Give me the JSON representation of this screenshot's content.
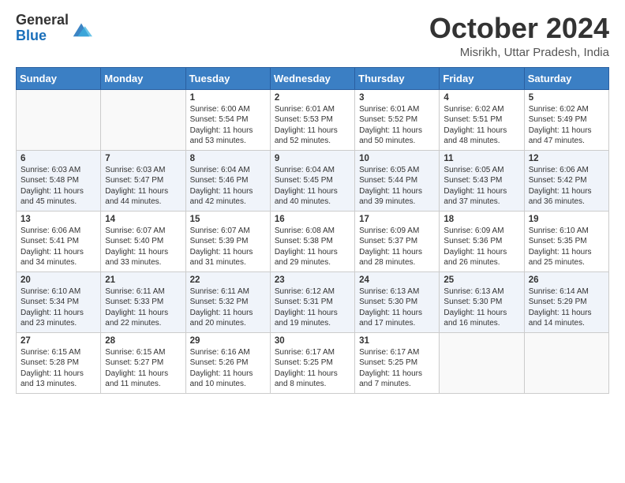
{
  "header": {
    "logo_general": "General",
    "logo_blue": "Blue",
    "month_title": "October 2024",
    "location": "Misrikh, Uttar Pradesh, India"
  },
  "days_of_week": [
    "Sunday",
    "Monday",
    "Tuesday",
    "Wednesday",
    "Thursday",
    "Friday",
    "Saturday"
  ],
  "weeks": [
    [
      {
        "day": "",
        "info": ""
      },
      {
        "day": "",
        "info": ""
      },
      {
        "day": "1",
        "info": "Sunrise: 6:00 AM\nSunset: 5:54 PM\nDaylight: 11 hours and 53 minutes."
      },
      {
        "day": "2",
        "info": "Sunrise: 6:01 AM\nSunset: 5:53 PM\nDaylight: 11 hours and 52 minutes."
      },
      {
        "day": "3",
        "info": "Sunrise: 6:01 AM\nSunset: 5:52 PM\nDaylight: 11 hours and 50 minutes."
      },
      {
        "day": "4",
        "info": "Sunrise: 6:02 AM\nSunset: 5:51 PM\nDaylight: 11 hours and 48 minutes."
      },
      {
        "day": "5",
        "info": "Sunrise: 6:02 AM\nSunset: 5:49 PM\nDaylight: 11 hours and 47 minutes."
      }
    ],
    [
      {
        "day": "6",
        "info": "Sunrise: 6:03 AM\nSunset: 5:48 PM\nDaylight: 11 hours and 45 minutes."
      },
      {
        "day": "7",
        "info": "Sunrise: 6:03 AM\nSunset: 5:47 PM\nDaylight: 11 hours and 44 minutes."
      },
      {
        "day": "8",
        "info": "Sunrise: 6:04 AM\nSunset: 5:46 PM\nDaylight: 11 hours and 42 minutes."
      },
      {
        "day": "9",
        "info": "Sunrise: 6:04 AM\nSunset: 5:45 PM\nDaylight: 11 hours and 40 minutes."
      },
      {
        "day": "10",
        "info": "Sunrise: 6:05 AM\nSunset: 5:44 PM\nDaylight: 11 hours and 39 minutes."
      },
      {
        "day": "11",
        "info": "Sunrise: 6:05 AM\nSunset: 5:43 PM\nDaylight: 11 hours and 37 minutes."
      },
      {
        "day": "12",
        "info": "Sunrise: 6:06 AM\nSunset: 5:42 PM\nDaylight: 11 hours and 36 minutes."
      }
    ],
    [
      {
        "day": "13",
        "info": "Sunrise: 6:06 AM\nSunset: 5:41 PM\nDaylight: 11 hours and 34 minutes."
      },
      {
        "day": "14",
        "info": "Sunrise: 6:07 AM\nSunset: 5:40 PM\nDaylight: 11 hours and 33 minutes."
      },
      {
        "day": "15",
        "info": "Sunrise: 6:07 AM\nSunset: 5:39 PM\nDaylight: 11 hours and 31 minutes."
      },
      {
        "day": "16",
        "info": "Sunrise: 6:08 AM\nSunset: 5:38 PM\nDaylight: 11 hours and 29 minutes."
      },
      {
        "day": "17",
        "info": "Sunrise: 6:09 AM\nSunset: 5:37 PM\nDaylight: 11 hours and 28 minutes."
      },
      {
        "day": "18",
        "info": "Sunrise: 6:09 AM\nSunset: 5:36 PM\nDaylight: 11 hours and 26 minutes."
      },
      {
        "day": "19",
        "info": "Sunrise: 6:10 AM\nSunset: 5:35 PM\nDaylight: 11 hours and 25 minutes."
      }
    ],
    [
      {
        "day": "20",
        "info": "Sunrise: 6:10 AM\nSunset: 5:34 PM\nDaylight: 11 hours and 23 minutes."
      },
      {
        "day": "21",
        "info": "Sunrise: 6:11 AM\nSunset: 5:33 PM\nDaylight: 11 hours and 22 minutes."
      },
      {
        "day": "22",
        "info": "Sunrise: 6:11 AM\nSunset: 5:32 PM\nDaylight: 11 hours and 20 minutes."
      },
      {
        "day": "23",
        "info": "Sunrise: 6:12 AM\nSunset: 5:31 PM\nDaylight: 11 hours and 19 minutes."
      },
      {
        "day": "24",
        "info": "Sunrise: 6:13 AM\nSunset: 5:30 PM\nDaylight: 11 hours and 17 minutes."
      },
      {
        "day": "25",
        "info": "Sunrise: 6:13 AM\nSunset: 5:30 PM\nDaylight: 11 hours and 16 minutes."
      },
      {
        "day": "26",
        "info": "Sunrise: 6:14 AM\nSunset: 5:29 PM\nDaylight: 11 hours and 14 minutes."
      }
    ],
    [
      {
        "day": "27",
        "info": "Sunrise: 6:15 AM\nSunset: 5:28 PM\nDaylight: 11 hours and 13 minutes."
      },
      {
        "day": "28",
        "info": "Sunrise: 6:15 AM\nSunset: 5:27 PM\nDaylight: 11 hours and 11 minutes."
      },
      {
        "day": "29",
        "info": "Sunrise: 6:16 AM\nSunset: 5:26 PM\nDaylight: 11 hours and 10 minutes."
      },
      {
        "day": "30",
        "info": "Sunrise: 6:17 AM\nSunset: 5:25 PM\nDaylight: 11 hours and 8 minutes."
      },
      {
        "day": "31",
        "info": "Sunrise: 6:17 AM\nSunset: 5:25 PM\nDaylight: 11 hours and 7 minutes."
      },
      {
        "day": "",
        "info": ""
      },
      {
        "day": "",
        "info": ""
      }
    ]
  ]
}
